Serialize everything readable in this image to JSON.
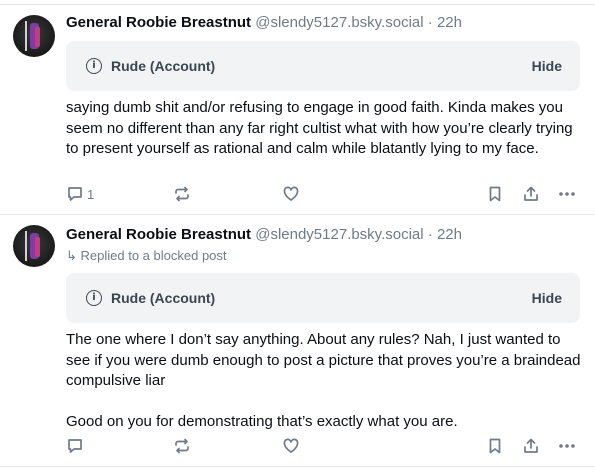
{
  "posts": [
    {
      "author_name": "General Roobie Breastnut",
      "handle": "@slendy5127.bsky.social",
      "separator": " · ",
      "time": "22h",
      "replied_to": "",
      "warning": {
        "icon": "info-icon",
        "label": "Rude (Account)",
        "action": "Hide"
      },
      "paragraphs": [
        "saying dumb shit and/or refusing to engage in good faith. Kinda makes you seem no different than any far right cultist what with how you’re clearly trying to present yourself as rational and calm while blatantly lying to my face."
      ],
      "reply_count": "1"
    },
    {
      "author_name": "General Roobie Breastnut",
      "handle": "@slendy5127.bsky.social",
      "separator": " · ",
      "time": "22h",
      "replied_to": "Replied to a blocked post",
      "warning": {
        "icon": "info-icon",
        "label": "Rude (Account)",
        "action": "Hide"
      },
      "paragraphs": [
        "The one where I don’t say anything. About any rules?  Nah, I just wanted to see if you were dumb enough to post a picture that proves you’re a braindead compulsive liar",
        "Good on you for demonstrating that’s exactly what you are."
      ],
      "reply_count": ""
    }
  ],
  "icons": {
    "reply": "reply-icon",
    "repost": "repost-icon",
    "like": "heart-icon",
    "bookmark": "bookmark-icon",
    "share": "share-icon",
    "more": "more-icon",
    "replied": "reply-arrow-icon"
  },
  "colors": {
    "text": "#0b0f14",
    "muted": "#6f7b88",
    "warning_bg": "#f1f3f5",
    "divider": "#e3e7ec"
  }
}
